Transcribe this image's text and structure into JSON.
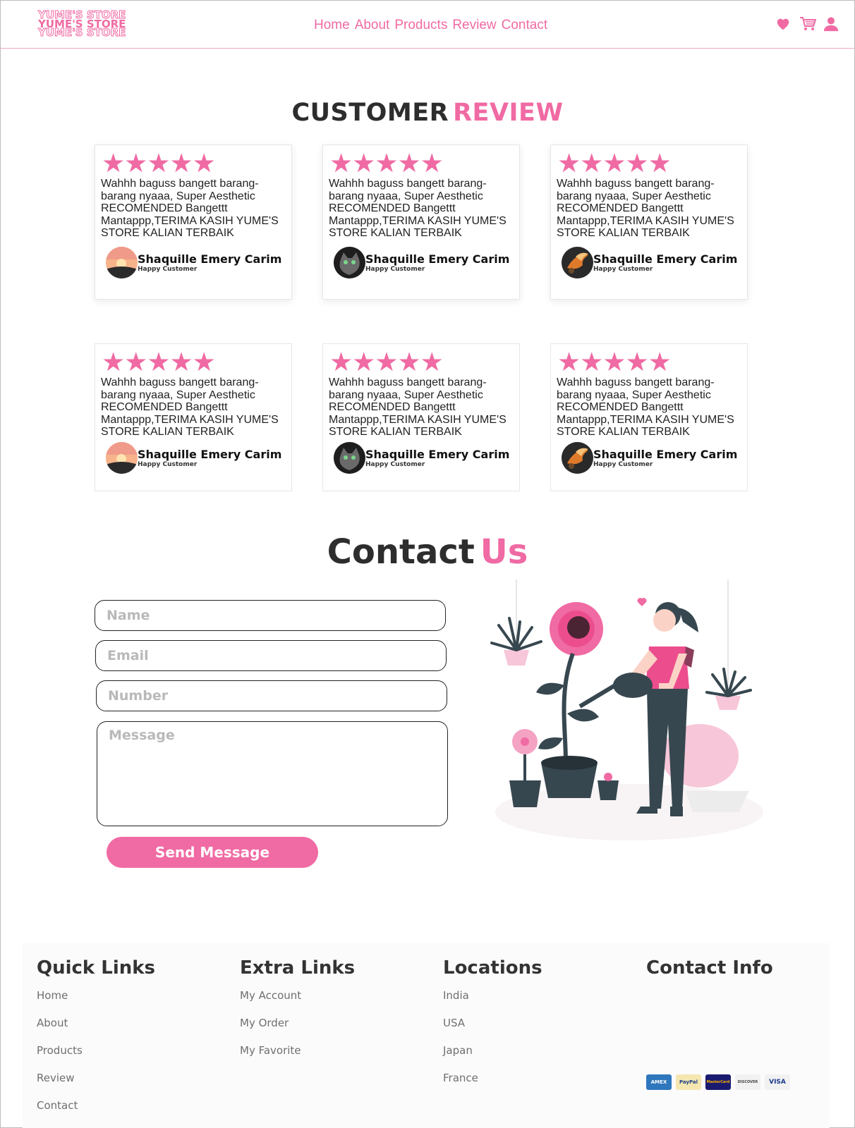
{
  "brand": {
    "logo_lines": [
      "YUME'S STORE",
      "YUME'S STORE",
      "YUME'S STORE"
    ]
  },
  "nav": {
    "items": [
      "Home",
      "About",
      "Products",
      "Review",
      "Contact"
    ]
  },
  "header_icons": [
    "heart-icon",
    "cart-icon",
    "user-icon"
  ],
  "colors": {
    "accent": "#f06aa3",
    "dark": "#2d2d2d"
  },
  "review": {
    "title_dark": "CUSTOMER",
    "title_pink": "REVIEW",
    "stars": "★★★★★",
    "cards": [
      {
        "text": "Wahhh baguss bangett barang-barang nyaaa, Super Aesthetic RECOMENDED Bangettt Mantappp,TERIMA KASIH YUME'S STORE KALIAN TERBAIK",
        "name": "Shaquille Emery Carim",
        "role": "Happy Customer",
        "avatar": "sunset-avatar"
      },
      {
        "text": "Wahhh baguss bangett barang-barang nyaaa, Super Aesthetic RECOMENDED Bangettt Mantappp,TERIMA KASIH YUME'S STORE KALIAN TERBAIK",
        "name": "Shaquille Emery Carim",
        "role": "Happy Customer",
        "avatar": "cat-avatar"
      },
      {
        "text": "Wahhh baguss bangett barang-barang nyaaa, Super Aesthetic RECOMENDED Bangettt Mantappp,TERIMA KASIH YUME'S STORE KALIAN TERBAIK",
        "name": "Shaquille Emery Carim",
        "role": "Happy Customer",
        "avatar": "koi-avatar"
      },
      {
        "text": "Wahhh baguss bangett barang-barang nyaaa, Super Aesthetic RECOMENDED Bangettt Mantappp,TERIMA KASIH YUME'S STORE KALIAN TERBAIK",
        "name": "Shaquille Emery Carim",
        "role": "Happy Customer",
        "avatar": "sunset-avatar"
      },
      {
        "text": "Wahhh baguss bangett barang-barang nyaaa, Super Aesthetic RECOMENDED Bangettt Mantappp,TERIMA KASIH YUME'S STORE KALIAN TERBAIK",
        "name": "Shaquille Emery Carim",
        "role": "Happy Customer",
        "avatar": "cat-avatar"
      },
      {
        "text": "Wahhh baguss bangett barang-barang nyaaa, Super Aesthetic RECOMENDED Bangettt Mantappp,TERIMA KASIH YUME'S STORE KALIAN TERBAIK",
        "name": "Shaquille Emery Carim",
        "role": "Happy Customer",
        "avatar": "koi-avatar"
      }
    ]
  },
  "contact": {
    "title_dark": "Contact",
    "title_pink": "Us",
    "name_placeholder": "Name",
    "email_placeholder": "Email",
    "number_placeholder": "Number",
    "message_placeholder": "Message",
    "send_label": "Send Message"
  },
  "footer": {
    "quick_links": {
      "title": "Quick Links",
      "items": [
        "Home",
        "About",
        "Products",
        "Review",
        "Contact"
      ]
    },
    "extra_links": {
      "title": "Extra Links",
      "items": [
        "My Account",
        "My Order",
        "My Favorite"
      ]
    },
    "locations": {
      "title": "Locations",
      "items": [
        "India",
        "USA",
        "Japan",
        "France"
      ]
    },
    "contact_info": {
      "title": "Contact Info"
    },
    "payments": [
      "AMEX",
      "PayPal",
      "MasterCard",
      "DISCOVER",
      "VISA"
    ]
  }
}
